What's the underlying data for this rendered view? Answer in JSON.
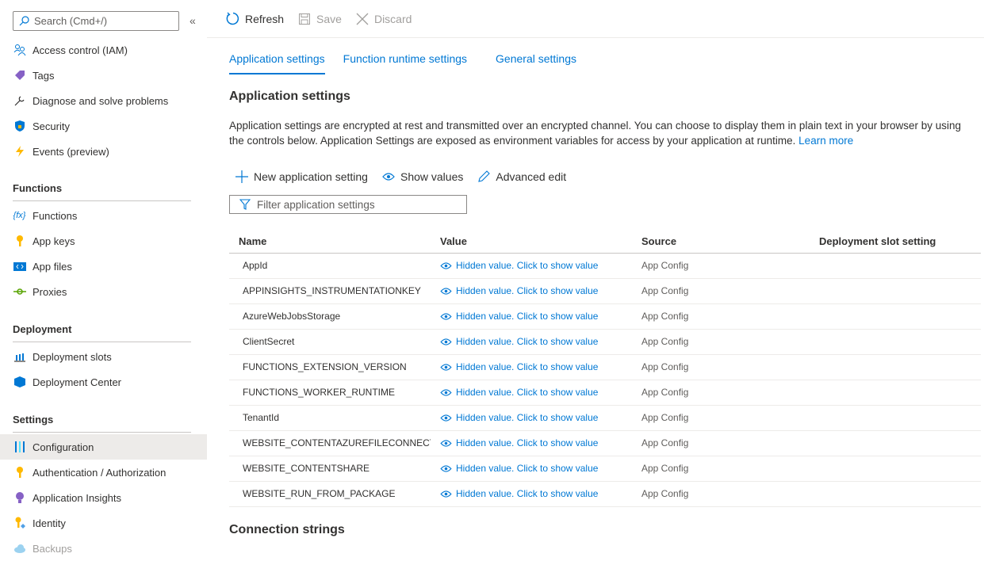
{
  "sidebar": {
    "search_placeholder": "Search (Cmd+/)",
    "items_top": [
      {
        "label": "Access control (IAM)",
        "icon": "people-icon"
      },
      {
        "label": "Tags",
        "icon": "tag-icon"
      },
      {
        "label": "Diagnose and solve problems",
        "icon": "wrench-icon"
      },
      {
        "label": "Security",
        "icon": "shield-icon"
      },
      {
        "label": "Events (preview)",
        "icon": "lightning-icon"
      }
    ],
    "sections": [
      {
        "title": "Functions",
        "items": [
          {
            "label": "Functions",
            "icon": "function-icon"
          },
          {
            "label": "App keys",
            "icon": "key-icon"
          },
          {
            "label": "App files",
            "icon": "code-file-icon"
          },
          {
            "label": "Proxies",
            "icon": "proxy-icon"
          }
        ]
      },
      {
        "title": "Deployment",
        "items": [
          {
            "label": "Deployment slots",
            "icon": "slots-icon"
          },
          {
            "label": "Deployment Center",
            "icon": "cube-icon"
          }
        ]
      },
      {
        "title": "Settings",
        "items": [
          {
            "label": "Configuration",
            "icon": "sliders-icon",
            "active": true
          },
          {
            "label": "Authentication / Authorization",
            "icon": "key-icon"
          },
          {
            "label": "Application Insights",
            "icon": "bulb-icon"
          },
          {
            "label": "Identity",
            "icon": "identity-key-icon"
          },
          {
            "label": "Backups",
            "icon": "cloud-icon",
            "disabled": true
          }
        ]
      }
    ]
  },
  "toolbar": {
    "refresh": "Refresh",
    "save": "Save",
    "discard": "Discard"
  },
  "tabs": [
    "Application settings",
    "Function runtime settings",
    "General settings"
  ],
  "app_settings": {
    "title": "Application settings",
    "description": "Application settings are encrypted at rest and transmitted over an encrypted channel. You can choose to display them in plain text in your browser by using the controls below. Application Settings are exposed as environment variables for access by your application at runtime.",
    "learn_more": "Learn more",
    "new_setting": "New application setting",
    "show_values": "Show values",
    "advanced_edit": "Advanced edit",
    "filter_placeholder": "Filter application settings",
    "columns": [
      "Name",
      "Value",
      "Source",
      "Deployment slot setting"
    ],
    "hidden_value": "Hidden value. Click to show value",
    "rows": [
      {
        "name": "AppId",
        "source": "App Config"
      },
      {
        "name": "APPINSIGHTS_INSTRUMENTATIONKEY",
        "source": "App Config"
      },
      {
        "name": "AzureWebJobsStorage",
        "source": "App Config"
      },
      {
        "name": "ClientSecret",
        "source": "App Config"
      },
      {
        "name": "FUNCTIONS_EXTENSION_VERSION",
        "source": "App Config"
      },
      {
        "name": "FUNCTIONS_WORKER_RUNTIME",
        "source": "App Config"
      },
      {
        "name": "TenantId",
        "source": "App Config"
      },
      {
        "name": "WEBSITE_CONTENTAZUREFILECONNECTIONSTRING",
        "source": "App Config"
      },
      {
        "name": "WEBSITE_CONTENTSHARE",
        "source": "App Config"
      },
      {
        "name": "WEBSITE_RUN_FROM_PACKAGE",
        "source": "App Config"
      }
    ]
  },
  "connection_strings": {
    "title": "Connection strings"
  },
  "colors": {
    "accent": "#0078d4",
    "active_bg": "#edebe9"
  }
}
